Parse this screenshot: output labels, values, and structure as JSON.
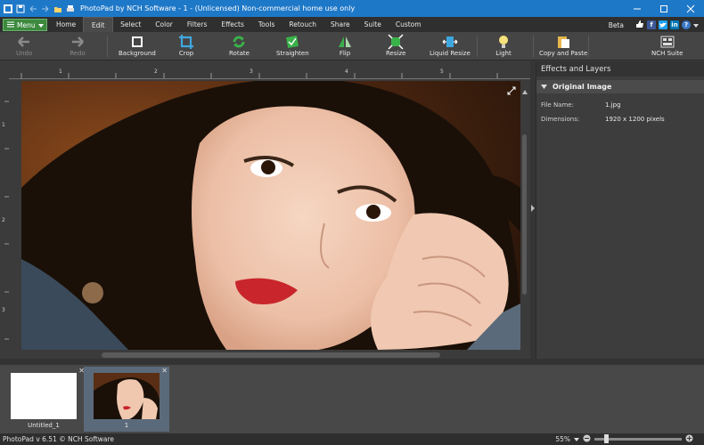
{
  "window": {
    "title": "PhotoPad by NCH Software - 1 - (Unlicensed) Non-commercial home use only"
  },
  "menu": {
    "menu_label": "Menu",
    "tabs": [
      "Home",
      "Edit",
      "Select",
      "Color",
      "Filters",
      "Effects",
      "Tools",
      "Retouch",
      "Share",
      "Suite",
      "Custom"
    ],
    "active_tab": "Edit",
    "beta_label": "Beta"
  },
  "toolbar": {
    "undo": "Undo",
    "redo": "Redo",
    "background": "Background",
    "crop": "Crop",
    "rotate": "Rotate",
    "straighten": "Straighten",
    "flip": "Flip",
    "resize": "Resize",
    "liquid_resize": "Liquid Resize",
    "light": "Light",
    "copy_paste": "Copy and Paste",
    "nch_suite": "NCH Suite"
  },
  "ruler": {
    "top_marks": [
      "1",
      "2",
      "3",
      "4",
      "5"
    ],
    "left_marks": [
      "1",
      "2",
      "3"
    ]
  },
  "panel": {
    "title": "Effects and Layers",
    "section": "Original Image",
    "file_name_label": "File Name:",
    "file_name_value": "1.jpg",
    "dimensions_label": "Dimensions:",
    "dimensions_value": "1920 x 1200 pixels"
  },
  "filmstrip": {
    "items": [
      {
        "label": "Untitled_1"
      },
      {
        "label": "1"
      }
    ]
  },
  "status": {
    "version": "PhotoPad v 6.51 © NCH Software",
    "zoom": "55%",
    "zoom_fraction": 0.55
  },
  "colors": {
    "titlebar": "#1e78c8",
    "menu_button": "#3d8a3f",
    "tool_icon_green": "#3bb14a",
    "tool_icon_blue": "#3fa7e0"
  }
}
